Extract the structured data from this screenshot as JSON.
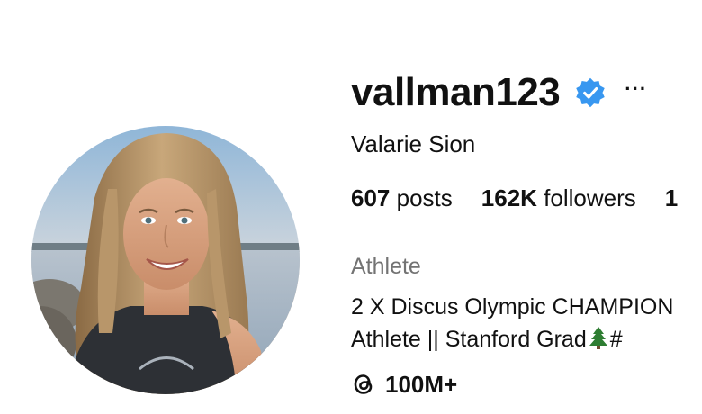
{
  "profile": {
    "username": "vallman123",
    "verified_icon": "verified-badge-icon",
    "more_icon": "more-options-icon",
    "more_label": "···",
    "full_name": "Valarie Sion",
    "stats": {
      "posts_count": "607",
      "posts_label": "posts",
      "followers_count": "162K",
      "followers_label": "followers",
      "following_partial": "1"
    },
    "category": "Athlete",
    "bio": {
      "line1": "2 X Discus Olympic CHAMPION",
      "line2_text": "Athlete || Stanford Grad",
      "line2_emoji": "evergreen-tree-icon",
      "line2_suffix": "#"
    },
    "threads": {
      "icon": "threads-icon",
      "count": "100M+"
    }
  },
  "colors": {
    "text": "#111111",
    "secondary_text": "#737373",
    "verified_blue": "#3897F0",
    "background": "#ffffff"
  }
}
